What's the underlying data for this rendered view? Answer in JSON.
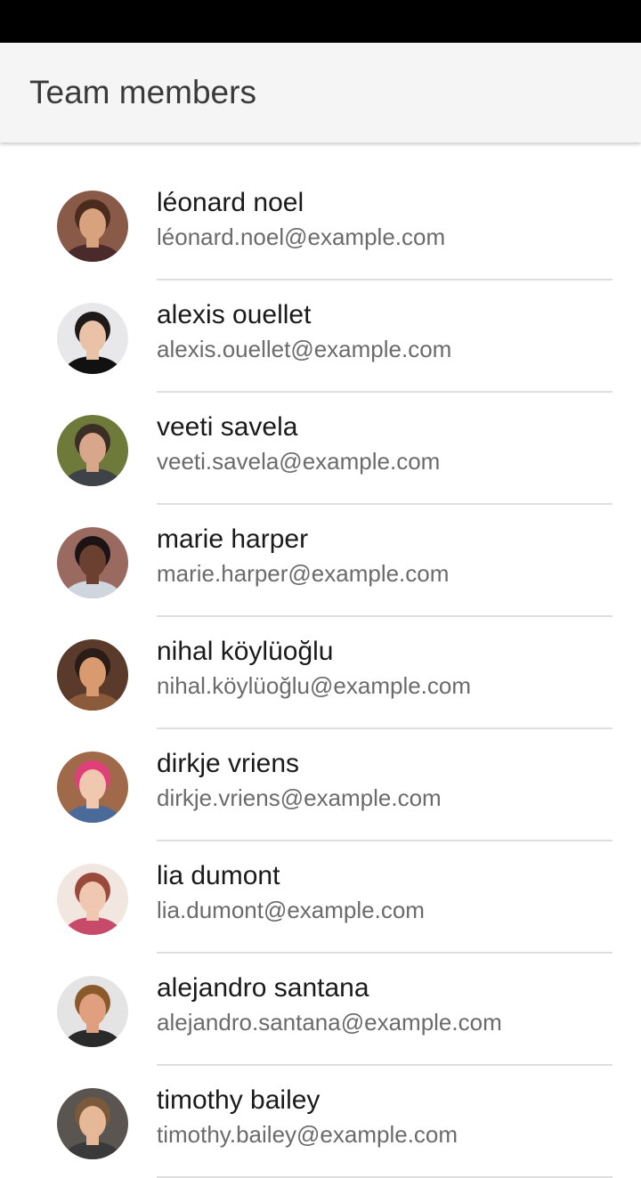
{
  "header": {
    "title": "Team members"
  },
  "colors": {
    "status_bar": "#000000",
    "app_bar": "#f5f5f5",
    "name_text": "#1a1a1a",
    "email_text": "#6b6b6b",
    "divider": "#dedede"
  },
  "members": [
    {
      "name": "léonard noel",
      "email": "léonard.noel@example.com",
      "avatar_bg": "#8a5a48",
      "avatar_face": "#d9a27e",
      "avatar_hair": "#4a2c1e",
      "avatar_shirt": "#4a2a2a"
    },
    {
      "name": "alexis ouellet",
      "email": "alexis.ouellet@example.com",
      "avatar_bg": "#e8e8ea",
      "avatar_face": "#e9c2a8",
      "avatar_hair": "#1e1a1a",
      "avatar_shirt": "#111111"
    },
    {
      "name": "veeti savela",
      "email": "veeti.savela@example.com",
      "avatar_bg": "#6d7a3a",
      "avatar_face": "#d8a68a",
      "avatar_hair": "#3a2e26",
      "avatar_shirt": "#3f4246"
    },
    {
      "name": "marie harper",
      "email": "marie.harper@example.com",
      "avatar_bg": "#9a6a60",
      "avatar_face": "#6b4030",
      "avatar_hair": "#1c1414",
      "avatar_shirt": "#cfd6de"
    },
    {
      "name": "nihal köylüoğlu",
      "email": "nihal.köylüoğlu@example.com",
      "avatar_bg": "#5a3a2a",
      "avatar_face": "#d89a6e",
      "avatar_hair": "#2a1c16",
      "avatar_shirt": "#8a5a3a"
    },
    {
      "name": "dirkje vriens",
      "email": "dirkje.vriens@example.com",
      "avatar_bg": "#a06a4a",
      "avatar_face": "#f0c8b0",
      "avatar_hair": "#e0407a",
      "avatar_shirt": "#4a6a9a"
    },
    {
      "name": "lia dumont",
      "email": "lia.dumont@example.com",
      "avatar_bg": "#f2e6e0",
      "avatar_face": "#f0c8b2",
      "avatar_hair": "#9a4a3a",
      "avatar_shirt": "#c84a6a"
    },
    {
      "name": "alejandro santana",
      "email": "alejandro.santana@example.com",
      "avatar_bg": "#e4e4e4",
      "avatar_face": "#e0a080",
      "avatar_hair": "#8a5a2a",
      "avatar_shirt": "#2a2a2a"
    },
    {
      "name": "timothy bailey",
      "email": "timothy.bailey@example.com",
      "avatar_bg": "#5a5550",
      "avatar_face": "#e6b898",
      "avatar_hair": "#7a5a3a",
      "avatar_shirt": "#3a3a3a"
    }
  ]
}
